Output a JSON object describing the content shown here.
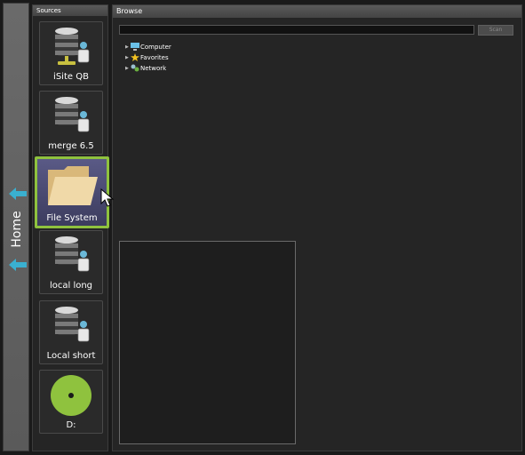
{
  "home": {
    "label": "Home"
  },
  "sources": {
    "title": "Sources",
    "items": [
      {
        "label": "iSite QB",
        "icon": "database-server-icon"
      },
      {
        "label": "merge 6.5",
        "icon": "database-server-icon"
      },
      {
        "label": "File System",
        "icon": "folder-icon",
        "selected": true
      },
      {
        "label": "local long",
        "icon": "database-server-icon"
      },
      {
        "label": "Local short",
        "icon": "database-server-icon"
      },
      {
        "label": "D:",
        "icon": "disc-icon"
      }
    ]
  },
  "browse": {
    "title": "Browse",
    "path_value": "",
    "scan_label": "Scan",
    "tree": [
      {
        "label": "Computer",
        "icon": "computer-icon"
      },
      {
        "label": "Favorites",
        "icon": "star-icon"
      },
      {
        "label": "Network",
        "icon": "network-icon"
      }
    ]
  },
  "colors": {
    "accent": "#8fc23e",
    "arrow": "#3ab0d0",
    "selected_bg": "#4a4a74"
  }
}
